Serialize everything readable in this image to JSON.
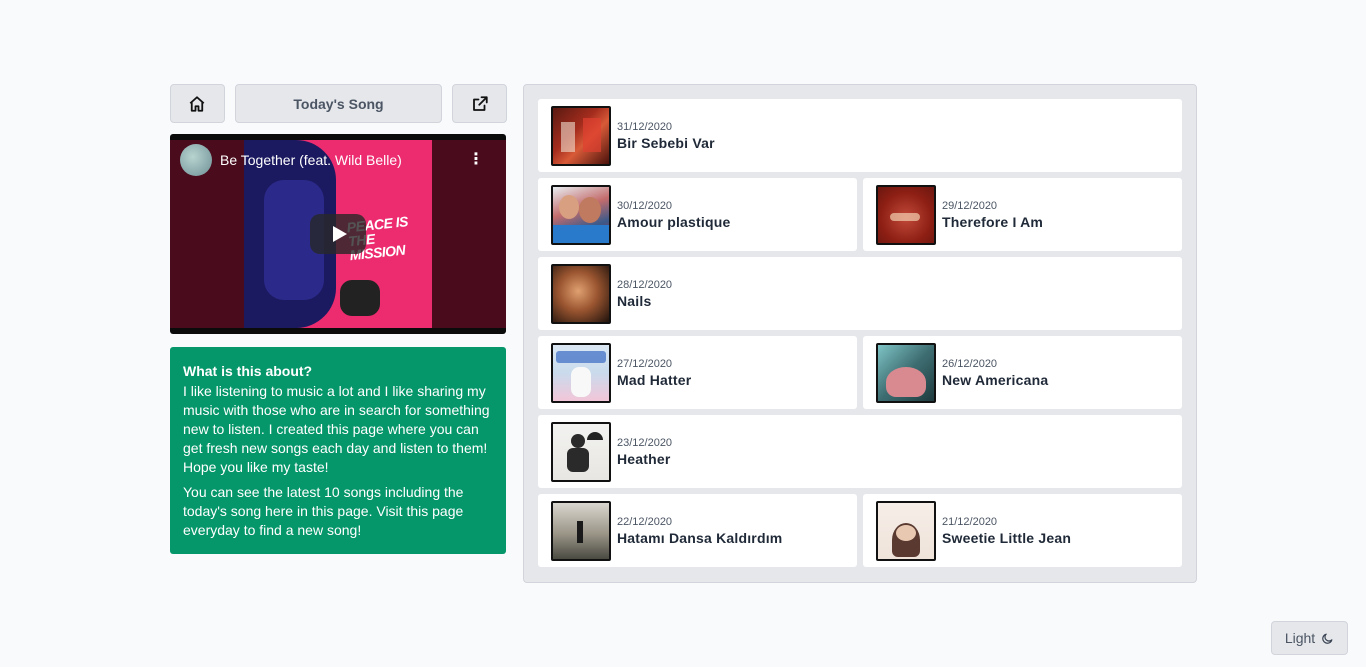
{
  "header": {
    "title": "Today's Song",
    "home_icon": "home-icon",
    "external_icon": "external-link-icon"
  },
  "video": {
    "title": "Be Together (feat. Wild Belle)",
    "art_text": "PEACE IS THE MISSION"
  },
  "about": {
    "heading": "What is this about?",
    "p1": "I like listening to music a lot and I like sharing my music with those who are in search for something new to listen. I created this page where you can get fresh new songs each day and listen to them! Hope you like my taste!",
    "p2": "You can see the latest 10 songs including the today's song here in this page. Visit this page everyday to find a new song!"
  },
  "songs": [
    {
      "date": "31/12/2020",
      "title": "Bir Sebebi Var"
    },
    {
      "date": "30/12/2020",
      "title": "Amour plastique"
    },
    {
      "date": "29/12/2020",
      "title": "Therefore I Am"
    },
    {
      "date": "28/12/2020",
      "title": "Nails"
    },
    {
      "date": "27/12/2020",
      "title": "Mad Hatter"
    },
    {
      "date": "26/12/2020",
      "title": "New Americana"
    },
    {
      "date": "23/12/2020",
      "title": "Heather"
    },
    {
      "date": "22/12/2020",
      "title": "Hatamı Dansa Kaldırdım"
    },
    {
      "date": "21/12/2020",
      "title": "Sweetie Little Jean"
    }
  ],
  "theme": {
    "label": "Light",
    "icon": "moon-icon"
  },
  "colors": {
    "accent_green": "#059669",
    "panel_bg": "#e5e7eb",
    "page_bg": "#f8fafc"
  }
}
